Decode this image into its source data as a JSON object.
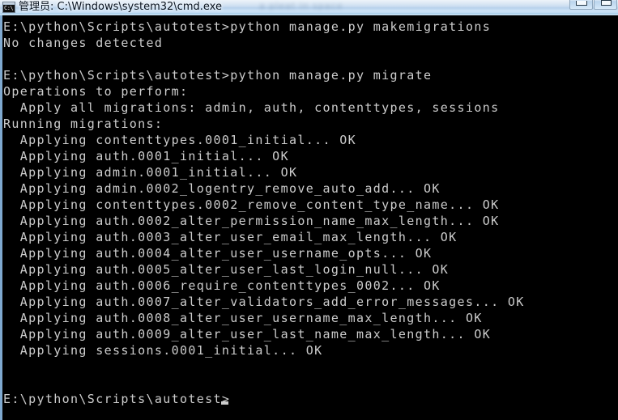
{
  "window": {
    "title": "管理员: C:\\Windows\\system32\\cmd.exe",
    "watermark": "a pleat in space",
    "icon_name": "cmd-console-icon",
    "icon_text": "C:\\",
    "buttons": {
      "minimize_label": "Minimize",
      "maximize_label": "Maximize"
    },
    "colors": {
      "titlebar": "#c4d9ef",
      "console_background": "#000000",
      "console_foreground": "#cccccc",
      "border": "#7fa9d0"
    }
  },
  "console": {
    "prompt": "E:\\python\\Scripts\\autotest>",
    "cursor": {
      "visible": true,
      "column": 26,
      "line_index": 23
    },
    "lines": [
      "E:\\python\\Scripts\\autotest>python manage.py makemigrations",
      "No changes detected",
      "",
      "E:\\python\\Scripts\\autotest>python manage.py migrate",
      "Operations to perform:",
      "  Apply all migrations: admin, auth, contenttypes, sessions",
      "Running migrations:",
      "  Applying contenttypes.0001_initial... OK",
      "  Applying auth.0001_initial... OK",
      "  Applying admin.0001_initial... OK",
      "  Applying admin.0002_logentry_remove_auto_add... OK",
      "  Applying contenttypes.0002_remove_content_type_name... OK",
      "  Applying auth.0002_alter_permission_name_max_length... OK",
      "  Applying auth.0003_alter_user_email_max_length... OK",
      "  Applying auth.0004_alter_user_username_opts... OK",
      "  Applying auth.0005_alter_user_last_login_null... OK",
      "  Applying auth.0006_require_contenttypes_0002... OK",
      "  Applying auth.0007_alter_validators_add_error_messages... OK",
      "  Applying auth.0008_alter_user_username_max_length... OK",
      "  Applying auth.0009_alter_user_last_name_max_length... OK",
      "  Applying sessions.0001_initial... OK",
      "",
      "",
      "E:\\python\\Scripts\\autotest>"
    ]
  }
}
